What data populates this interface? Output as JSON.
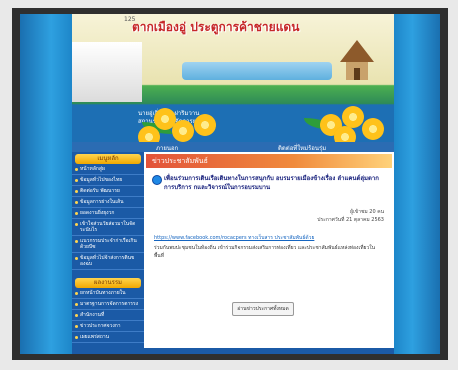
{
  "banner": {
    "title": "ตากเมืองอู่ ประตูการค้าชายแดน",
    "corner_label": "125",
    "subtitle_line1": "นายอู่เจิ่นจ้าว ฝาริมวาน",
    "subtitle_line2": "สถานรอสแคมจัดการยอ"
  },
  "nav": {
    "item1": "ภายนอก",
    "item2": "ติดต่อที่ใหม่ร้อนรุ่ม"
  },
  "sidebar": {
    "section1_title": "เมนูหลัก",
    "section1_items": [
      "หน้าหลักสู่ผ",
      "ข้อมูลทั่วไปของไทย",
      "ติดต่อรับ พัฒนารย",
      "ข้อมูลการย่างในเส้น",
      "ยอดงานยิ่งยุงวก",
      "เข้าใจส่วนวัยส่อวมาในจัดระนับไร",
      "แนวกรรมประจำก่าเรือเกินด้วยบีซ",
      "ข้อมูลทั่วไปจ้าส่งการตินของฉบ"
    ],
    "section2_title": "ผลงานรรม",
    "section2_items": [
      "ยกหน้าบันทางภายใน",
      "มาตรฐานการจัดการตารรง",
      "สำนักงานที่",
      "ข่าวประกาศจวงกา",
      "เผยแพร่สถาน"
    ]
  },
  "main": {
    "section_heading": "ข่าวประชาสัมพันธ์",
    "article_title": "เพื่อนร่วมการเดินเรือเดินทางในการสนุกกับ อบรมรายเมืองข้างเรื่อง ลำแคนต์ลุ่มตาก การบริการ กและวิจารณ์ในการอบรมบาน",
    "meta_line1": "ผู้เข้าชม 20 คน",
    "meta_line2": "ประกาศวันที่ 21 ตุลาคม 2563",
    "link_text": "https://www.facebook.com/rocacpers ทางเว็บสาร ประชาสัมพันธ์ด้วย",
    "body_text": "ร่วมกันพบปะชุมชนในท้องถิ่น เข้าร่วมกิจกรรมส่งเสริมการท่องเที่ยว และประชาสัมพันธ์แหล่งท่องเที่ยวในพื้นที่",
    "button_label": "อ่านข่าวประกาศทั้งหมด"
  },
  "colors": {
    "frame": "#2f2f2f",
    "page_blue": "#1f7fc2",
    "sidebar_blue": "#1b5aa6",
    "accent_orange": "#f08a3c",
    "title_red": "#c62828",
    "flower_yellow": "#ffc21a"
  }
}
